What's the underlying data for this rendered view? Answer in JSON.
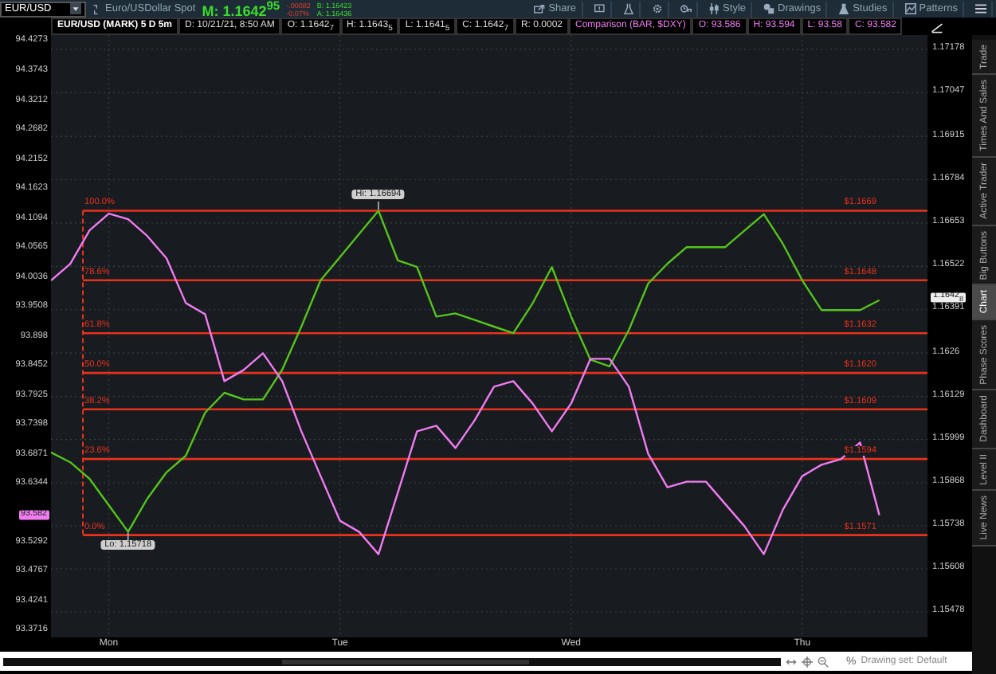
{
  "toolbar": {
    "symbol": "EUR/USD",
    "description": "Euro/USDollar Spot",
    "mark": "M: 1.1642$^{95}$",
    "change": "-.00082",
    "change_percent": "-0.07%",
    "bid": "B: 1.16423",
    "ask": "A: 1.16436",
    "buttons": [
      {
        "kind": "share",
        "label": "Share"
      },
      {
        "kind": "alert"
      },
      {
        "kind": "flask"
      },
      {
        "kind": "gear"
      },
      {
        "kind": "timeframe"
      },
      {
        "kind": "style",
        "label": "Style"
      },
      {
        "kind": "drawings",
        "label": "Drawings"
      },
      {
        "kind": "studies",
        "label": "Studies"
      },
      {
        "kind": "patterns",
        "label": "Patterns"
      },
      {
        "kind": "menu"
      }
    ]
  },
  "info_bar": [
    {
      "kind": "title",
      "text": "EUR/USD (MARK) 5 D 5m"
    },
    {
      "kind": "main",
      "text": "D: 10/21/21, 8:50 AM"
    },
    {
      "kind": "main",
      "text": "O: 1.1642$_{7}$"
    },
    {
      "kind": "main",
      "text": "H: 1.1643$_{5}$"
    },
    {
      "kind": "main",
      "text": "L: 1.1641$_{5}$"
    },
    {
      "kind": "main",
      "text": "C: 1.1642$_{7}$"
    },
    {
      "kind": "main",
      "text": "R: 0.0002"
    },
    {
      "kind": "comparison",
      "text": "Comparison (BAR, $DXY)"
    },
    {
      "kind": "comparison",
      "text": "O: 93.586"
    },
    {
      "kind": "comparison",
      "text": "H: 93.594"
    },
    {
      "kind": "comparison",
      "text": "L: 93.58"
    },
    {
      "kind": "comparison",
      "text": "C: 93.582"
    }
  ],
  "chart": {
    "last_price": "1.1642$_{8}$",
    "fib_percent_labels": [
      "100.0%",
      "78.6%",
      "61.8%",
      "50.0%",
      "38.2%",
      "23.6%",
      "0.0%"
    ],
    "chart_data": {
      "type": "line",
      "grid": true,
      "ylim": [
        1.15401,
        1.17221
      ],
      "categories": [
        null,
        null,
        null,
        "Mon",
        null,
        null,
        null,
        null,
        null,
        null,
        null,
        null,
        null,
        null,
        null,
        "Tue",
        null,
        null,
        null,
        null,
        null,
        null,
        null,
        null,
        null,
        null,
        null,
        "Wed",
        null,
        null,
        null,
        null,
        null,
        null,
        null,
        null,
        null,
        null,
        null,
        "Thu",
        null,
        null,
        null,
        null,
        null,
        null
      ],
      "series": [
        {
          "color": "#56c41c",
          "values": [
            1.1596,
            1.1593,
            1.1588,
            1.158,
            1.1572,
            1.1582,
            1.159,
            1.1595,
            1.1608,
            1.1614,
            1.1612,
            1.1612,
            1.1621,
            1.1634,
            1.1648,
            1.1655,
            1.1662,
            1.1669,
            1.1654,
            1.1652,
            1.1637,
            1.1638,
            1.1636,
            1.1634,
            1.1632,
            1.1641,
            1.1652,
            1.1637,
            1.1624,
            1.1622,
            1.1633,
            1.1647,
            1.1653,
            1.1658,
            1.1658,
            1.1658,
            1.1663,
            1.1668,
            1.1659,
            1.1648,
            1.1639,
            1.1639,
            1.1639,
            1.1642,
            null,
            null
          ]
        }
      ],
      "yticks": [
        1.17178,
        1.17047,
        1.16915,
        1.16784,
        1.16653,
        1.16522,
        1.16391,
        1.1626,
        1.16129,
        1.15999,
        1.15868,
        1.15738,
        1.15608,
        1.15478
      ],
      "ref_lines": [
        {
          "axis": "y",
          "value": 1.1669,
          "label": "$1.1669"
        },
        {
          "axis": "y",
          "value": 1.1648,
          "label": "$1.1648"
        },
        {
          "axis": "y",
          "value": 1.1632,
          "label": "$1.1632"
        },
        {
          "axis": "y",
          "value": 1.162,
          "label": "$1.1620"
        },
        {
          "axis": "y",
          "value": 1.1609,
          "label": "$1.1609"
        },
        {
          "axis": "y",
          "value": 1.1594,
          "label": "$1.1594"
        },
        {
          "axis": "y",
          "value": 1.1571,
          "label": "$1.1571"
        }
      ],
      "annotations": [
        {
          "y": 1.16694,
          "text": "Hi: 1.16694"
        },
        {
          "y": 1.15718,
          "text": "Lo: 1.15718"
        }
      ]
    }
  },
  "comparison": {
    "last_price": "93.582",
    "chart_data": {
      "type": "line",
      "ylim": [
        93.361,
        94.44
      ],
      "categories": [
        null,
        null,
        null,
        null,
        null,
        null,
        null,
        null,
        null,
        null,
        null,
        null,
        null,
        null,
        null,
        null,
        null,
        null,
        null,
        null,
        null,
        null,
        null,
        null,
        null,
        null,
        null,
        null,
        null,
        null,
        null,
        null,
        null,
        null,
        null,
        null,
        null,
        null,
        null,
        null,
        null,
        null,
        null,
        null,
        null,
        null
      ],
      "series": [
        {
          "color": "#f07cf0",
          "values": [
            94.0,
            94.03,
            94.09,
            94.12,
            94.11,
            94.08,
            94.04,
            93.96,
            93.94,
            93.82,
            93.84,
            93.87,
            93.82,
            93.73,
            93.65,
            93.57,
            93.55,
            93.51,
            93.62,
            93.73,
            93.74,
            93.7,
            93.75,
            93.81,
            93.82,
            93.78,
            93.73,
            93.78,
            93.86,
            93.86,
            93.81,
            93.69,
            93.63,
            93.64,
            93.64,
            93.6,
            93.56,
            93.51,
            93.59,
            93.65,
            93.67,
            93.68,
            93.71,
            93.58,
            null,
            null
          ]
        }
      ],
      "yticks": [
        94.4273,
        94.3743,
        94.3212,
        94.2682,
        94.2152,
        94.1623,
        94.1094,
        94.0565,
        94.0036,
        93.9508,
        93.898,
        93.8452,
        93.7925,
        93.7398,
        93.6871,
        93.6344,
        93.5292,
        93.4767,
        93.4241,
        93.3716
      ]
    }
  },
  "side_tabs": [
    {
      "label": "Trade",
      "selected": false
    },
    {
      "label": "Times And Sales",
      "selected": false
    },
    {
      "label": "Active Trader",
      "selected": false
    },
    {
      "label": "Big Buttons",
      "selected": false
    },
    {
      "label": "Chart",
      "selected": true
    },
    {
      "label": "Phase Scores",
      "selected": false
    },
    {
      "label": "Dashboard",
      "selected": false
    },
    {
      "label": "Level II",
      "selected": false
    },
    {
      "label": "Live News",
      "selected": false
    }
  ],
  "footer": {
    "percent": "%",
    "drawing_set": "Drawing set: Default"
  }
}
